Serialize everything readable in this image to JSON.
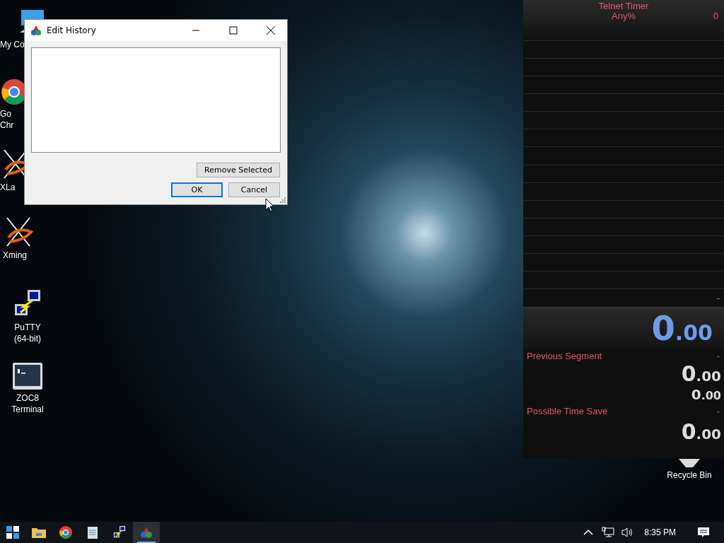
{
  "desktop_icons": [
    {
      "kind": "computer",
      "label": "My Co"
    },
    {
      "kind": "chrome",
      "label": "Go Chr"
    },
    {
      "kind": "x",
      "label": "XLa"
    },
    {
      "kind": "x",
      "label": "Xming"
    },
    {
      "kind": "putty",
      "label": "PuTTY (64-bit)"
    },
    {
      "kind": "terminal",
      "label": "ZOC8 Terminal"
    },
    {
      "kind": "recycle",
      "label": "Recycle Bin"
    }
  ],
  "dialog": {
    "title": "Edit History",
    "buttons": [
      {
        "kind": "remove",
        "label": "Remove Selected",
        "default": false
      },
      {
        "kind": "ok",
        "label": "OK",
        "default": true
      },
      {
        "kind": "cancel",
        "label": "Cancel",
        "default": false
      }
    ]
  },
  "timer": {
    "title": "Telnet Timer",
    "category": "Any%",
    "attempts": "0",
    "last_split_delta": "-",
    "main_time": {
      "whole": "0",
      "fraction": ".00"
    },
    "previous_segment": {
      "label": "Previous Segment",
      "value": "-"
    },
    "segment_time": {
      "whole": "0",
      "fraction": ".00"
    },
    "best_segment": {
      "whole": "0",
      "fraction": ".00"
    },
    "possible_time_save": {
      "label": "Possible Time Save",
      "value": "-"
    },
    "sum_time": {
      "whole": "0",
      "fraction": ".00"
    }
  },
  "taskbar": {
    "apps": [
      {
        "kind": "explorer",
        "selected": false
      },
      {
        "kind": "chrome",
        "selected": false
      },
      {
        "kind": "notepad",
        "selected": false
      },
      {
        "kind": "putty",
        "selected": false
      },
      {
        "kind": "timer",
        "selected": true
      }
    ],
    "clock": "8:35 PM"
  }
}
